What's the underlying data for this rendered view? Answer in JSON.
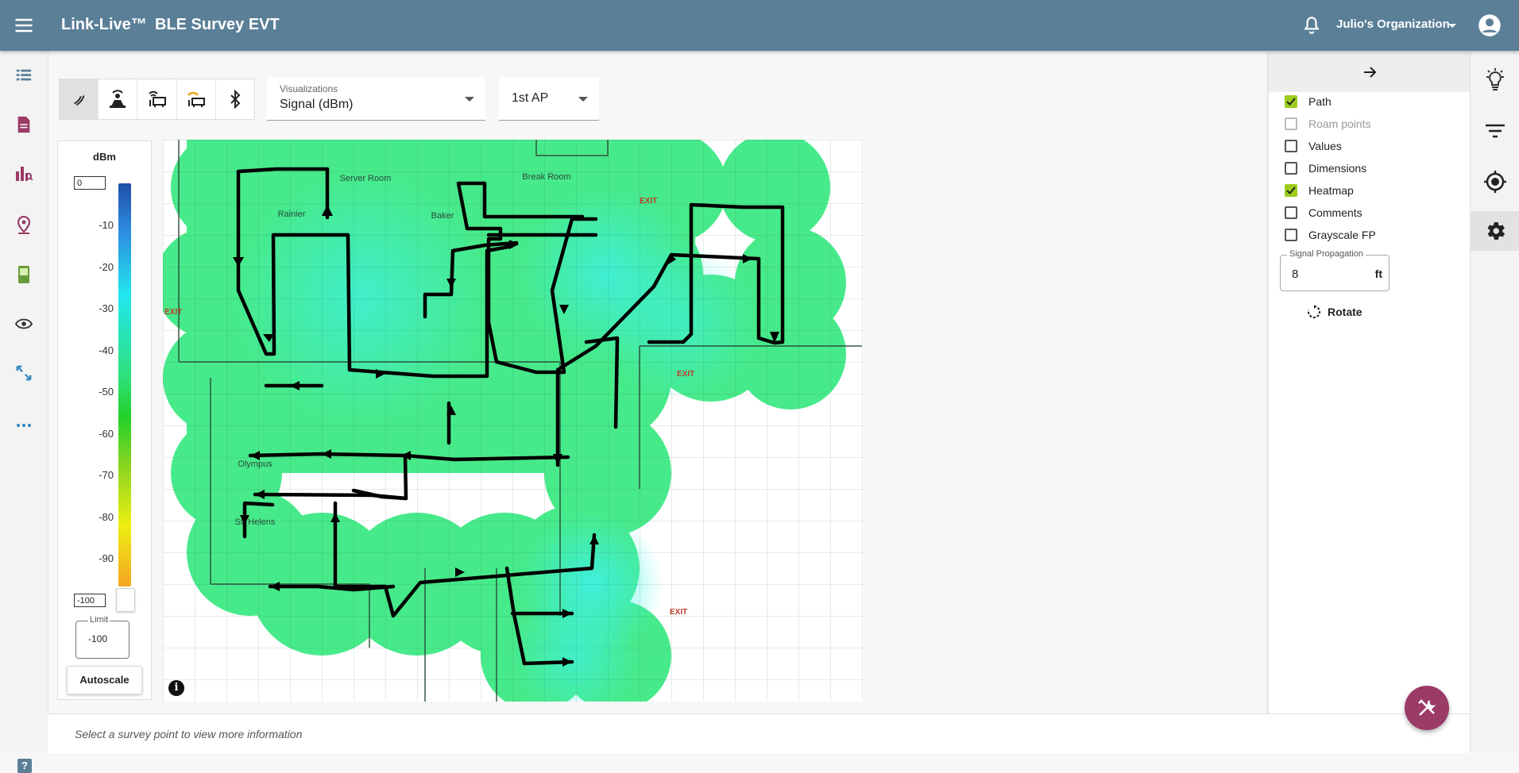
{
  "header": {
    "brand": "Link-Live™",
    "title": "BLE Survey EVT",
    "org": "Julio's Organization"
  },
  "left_rail": {
    "icons": [
      "list-icon",
      "document-icon",
      "chart-search-icon",
      "map-pin-icon",
      "device-icon",
      "eye-icon",
      "arrows-icon",
      "more-icon"
    ],
    "help_label": "?"
  },
  "toolbar": {
    "tools": [
      "ble-signal-icon",
      "beacon-icon",
      "ap-icon",
      "ap-overlay-icon",
      "bluetooth-icon"
    ],
    "active_index": 0
  },
  "visualization_select": {
    "label": "Visualizations",
    "value": "Signal (dBm)"
  },
  "ap_select": {
    "value": "1st AP"
  },
  "legend": {
    "unit": "dBm",
    "max_value": "0",
    "min_value": "-100",
    "ticks": [
      "-10",
      "-20",
      "-30",
      "-40",
      "-50",
      "-60",
      "-70",
      "-80",
      "-90"
    ],
    "limit_label": "Limit",
    "limit_value": "-100",
    "autoscale_label": "Autoscale"
  },
  "map": {
    "room_labels": [
      "Server Room",
      "Rainier",
      "Baker",
      "Break Room",
      "Olympus",
      "St. Helens",
      "EXIT",
      "EXIT",
      "EXIT",
      "EXIT"
    ],
    "info_label": "i"
  },
  "panel": {
    "options": [
      {
        "label": "Path",
        "checked": true,
        "disabled": false
      },
      {
        "label": "Roam points",
        "checked": false,
        "disabled": true
      },
      {
        "label": "Values",
        "checked": false,
        "disabled": false
      },
      {
        "label": "Dimensions",
        "checked": false,
        "disabled": false
      },
      {
        "label": "Heatmap",
        "checked": true,
        "disabled": false
      },
      {
        "label": "Comments",
        "checked": false,
        "disabled": false
      },
      {
        "label": "Grayscale FP",
        "checked": false,
        "disabled": false
      }
    ],
    "signal_propagation": {
      "label": "Signal Propagation",
      "value": "8",
      "unit": "ft"
    },
    "rotate_label": "Rotate"
  },
  "right_rail": {
    "icons": [
      "lightbulb-icon",
      "filter-icon",
      "target-icon",
      "gear-icon"
    ],
    "active_index": 3
  },
  "footer": {
    "message": "Select a survey point to view more information"
  },
  "colors": {
    "header": "#5a7f97",
    "accent": "#9b3b67",
    "checkbox": "#9ccc1e",
    "path": "#000000"
  }
}
